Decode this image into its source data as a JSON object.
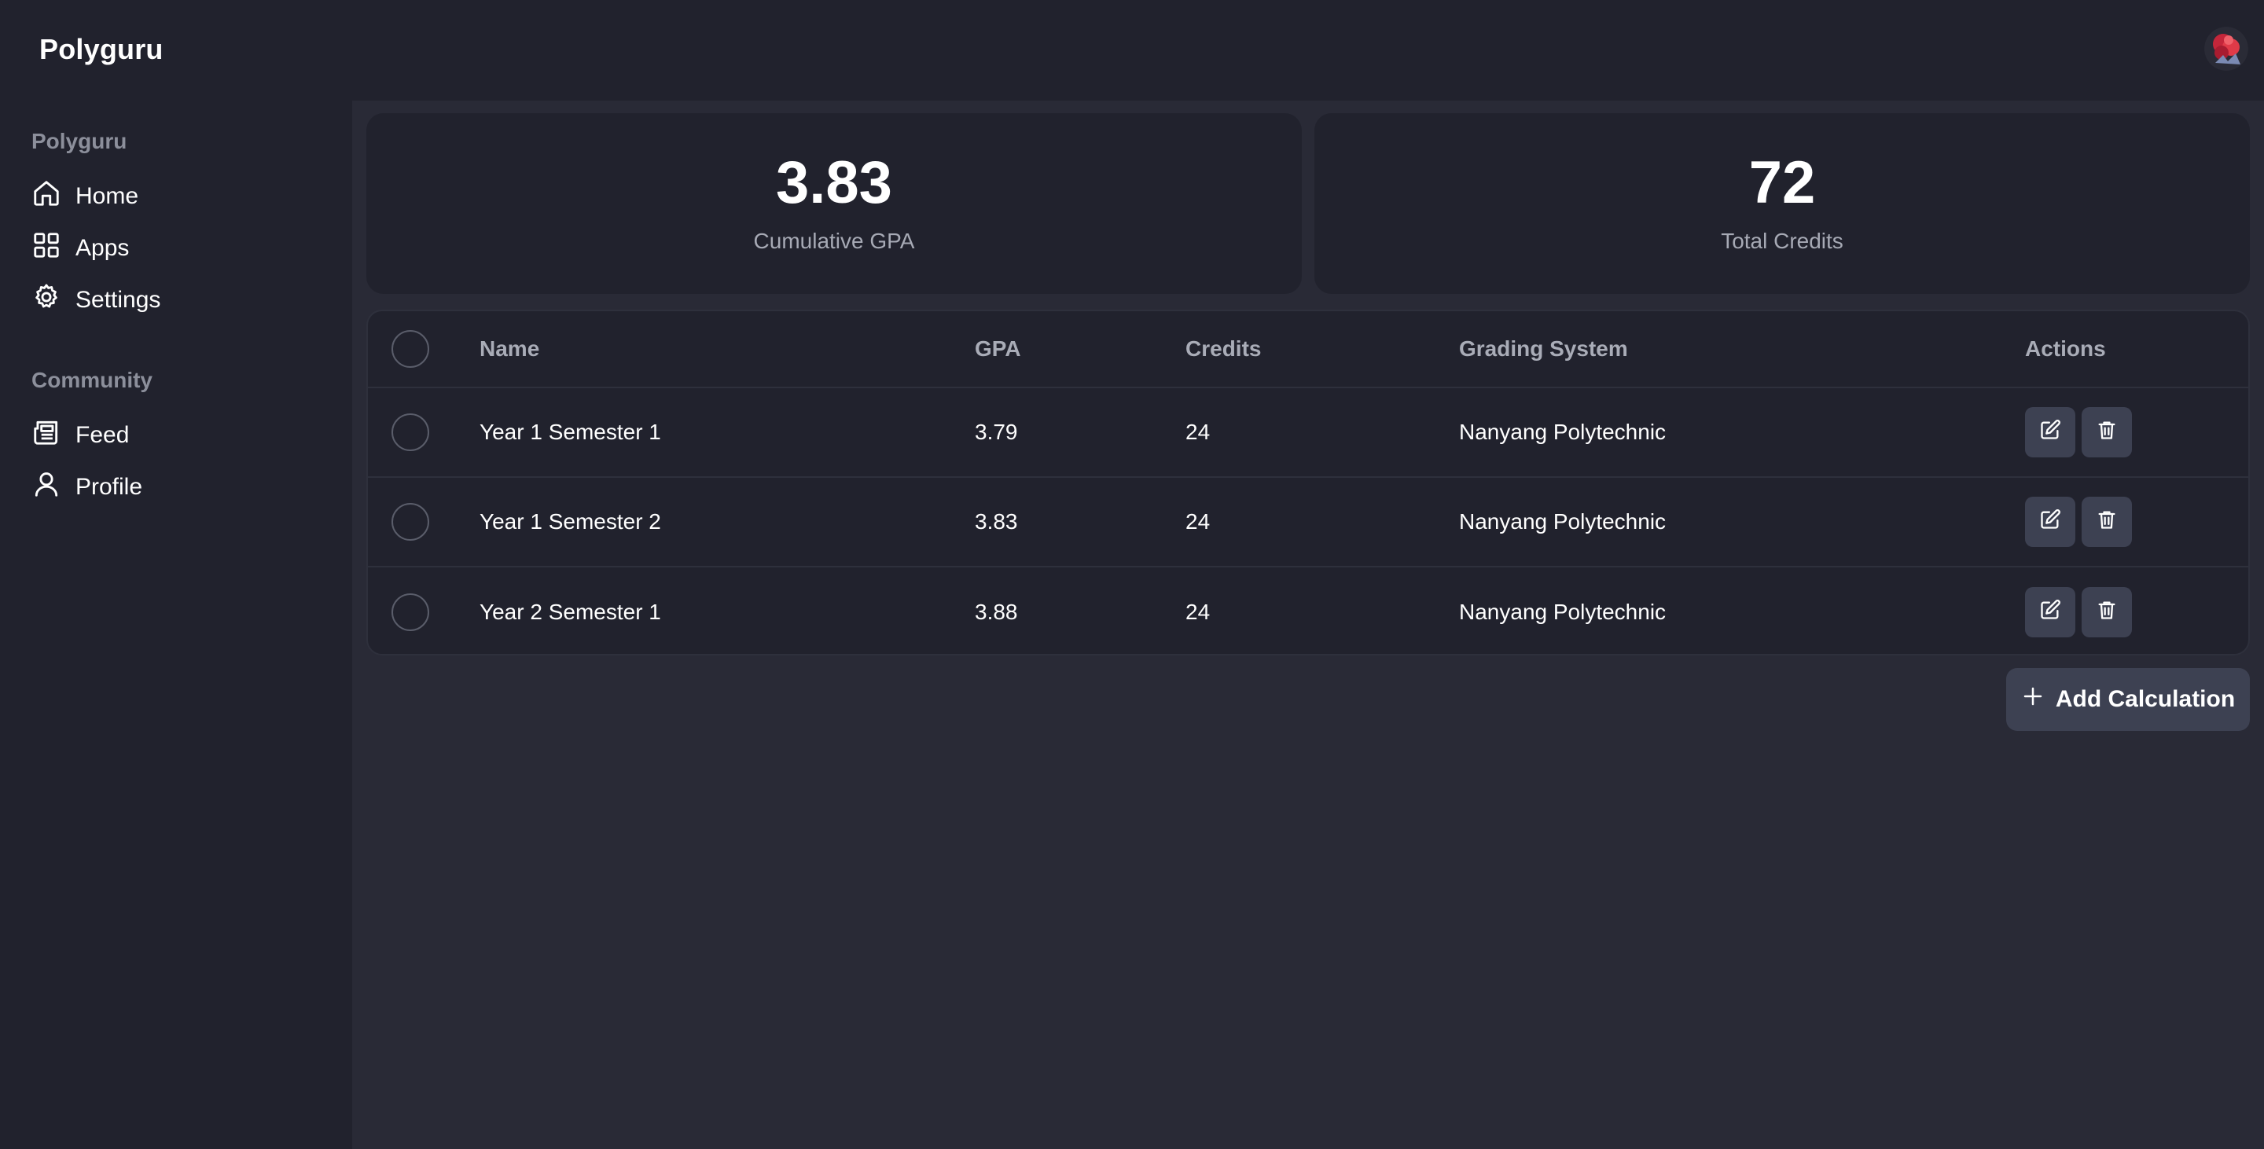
{
  "app": {
    "title": "Polyguru"
  },
  "sidebar": {
    "sections": [
      {
        "title": "Polyguru",
        "items": [
          {
            "label": "Home",
            "icon": "home-icon"
          },
          {
            "label": "Apps",
            "icon": "grid-icon"
          },
          {
            "label": "Settings",
            "icon": "gear-icon"
          }
        ]
      },
      {
        "title": "Community",
        "items": [
          {
            "label": "Feed",
            "icon": "newspaper-icon"
          },
          {
            "label": "Profile",
            "icon": "user-icon"
          }
        ]
      }
    ]
  },
  "stats": {
    "gpa": {
      "value": "3.83",
      "label": "Cumulative GPA"
    },
    "credits": {
      "value": "72",
      "label": "Total Credits"
    }
  },
  "table": {
    "columns": {
      "name": "Name",
      "gpa": "GPA",
      "credits": "Credits",
      "grading": "Grading System",
      "actions": "Actions"
    },
    "rows": [
      {
        "name": "Year 1 Semester 1",
        "gpa": "3.79",
        "credits": "24",
        "grading": "Nanyang Polytechnic"
      },
      {
        "name": "Year 1 Semester 2",
        "gpa": "3.83",
        "credits": "24",
        "grading": "Nanyang Polytechnic"
      },
      {
        "name": "Year 2 Semester 1",
        "gpa": "3.88",
        "credits": "24",
        "grading": "Nanyang Polytechnic"
      }
    ]
  },
  "actions": {
    "add_label": "Add Calculation"
  },
  "colors": {
    "sidebar_bg": "#21222d",
    "main_bg": "#292a36",
    "card_bg": "#21222d",
    "button_bg": "#3d4152"
  }
}
